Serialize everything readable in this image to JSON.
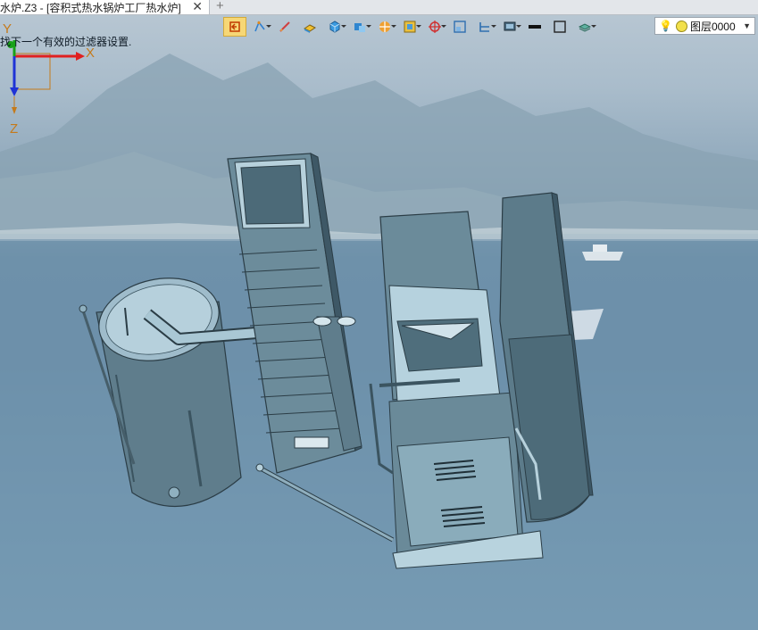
{
  "tab": {
    "title": "水炉.Z3 - [容积式热水锅炉工厂热水炉]",
    "close": "✕",
    "add": "+"
  },
  "toolbar": {
    "buttons": [
      {
        "name": "pick-filter-icon",
        "has_dropdown": false,
        "active": true
      },
      {
        "name": "snap-icon",
        "has_dropdown": true
      },
      {
        "name": "sketch-icon",
        "has_dropdown": false
      },
      {
        "name": "surface-icon",
        "has_dropdown": false
      },
      {
        "name": "solid-icon",
        "has_dropdown": true
      },
      {
        "name": "assembly-icon",
        "has_dropdown": true
      },
      {
        "name": "render-icon",
        "has_dropdown": true
      },
      {
        "name": "frame-icon",
        "has_dropdown": true
      },
      {
        "name": "origin-icon",
        "has_dropdown": true
      },
      {
        "name": "view-icon",
        "has_dropdown": false
      },
      {
        "name": "section-icon",
        "has_dropdown": true
      },
      {
        "name": "display-icon",
        "has_dropdown": true
      },
      {
        "name": "line-style-icon",
        "has_dropdown": false
      },
      {
        "name": "box-icon",
        "has_dropdown": false
      },
      {
        "name": "layer-icon",
        "has_dropdown": true
      }
    ],
    "layer": {
      "value": "图层0000",
      "dropdown": "▼"
    }
  },
  "status": {
    "message": "找下一个有效的过滤器设置."
  },
  "axes": {
    "x": "X",
    "y": "Y",
    "z": "Z"
  },
  "colors": {
    "model": "#5d7a88",
    "model_light": "#a9c7d4",
    "model_dark": "#3b5460",
    "axis_x": "#e02020",
    "axis_y": "#18a218",
    "axis_z": "#1f33d6",
    "axis_label": "#c57a1a"
  }
}
